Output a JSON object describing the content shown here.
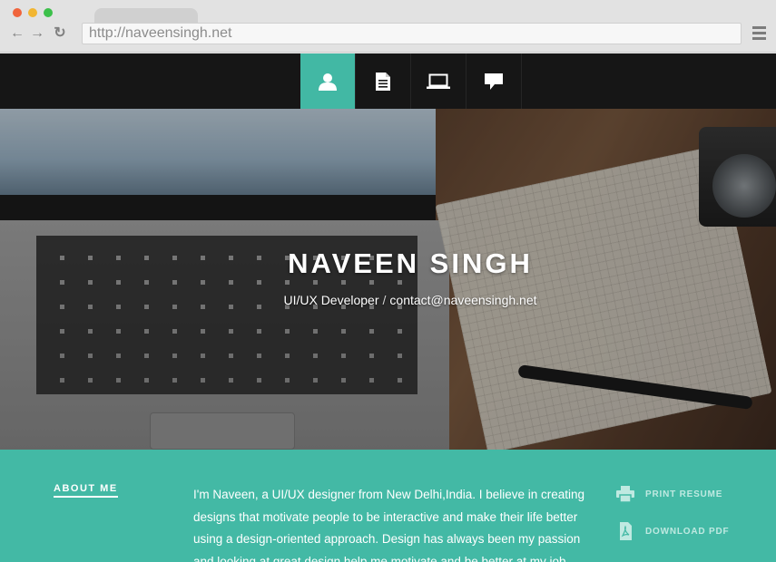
{
  "browser": {
    "url": "http://naveensingh.net",
    "icons": {
      "back": "back-arrow-icon",
      "forward": "forward-arrow-icon",
      "reload": "reload-icon",
      "menu": "hamburger-menu-icon"
    }
  },
  "nav": {
    "items": [
      {
        "icon": "user-icon",
        "active": true
      },
      {
        "icon": "document-icon",
        "active": false
      },
      {
        "icon": "laptop-icon",
        "active": false
      },
      {
        "icon": "speech-bubble-icon",
        "active": false
      }
    ],
    "accent": "#42b8a4"
  },
  "hero": {
    "title": "NAVEEN SINGH",
    "role": "UI/UX Developer",
    "separator": "/",
    "email": "contact@naveensingh.net"
  },
  "about": {
    "heading": "ABOUT ME",
    "paragraph": "I'm Naveen, a UI/UX designer from New Delhi,India. I believe in creating designs that motivate people to be interactive and make their life better using a design-oriented approach. Design has always been my passion and looking at great design help me motivate and be better at my job.",
    "background": "#43b9a5"
  },
  "actions": {
    "print_label": "PRINT RESUME",
    "pdf_label": "DOWNLOAD PDF",
    "print_icon": "printer-icon",
    "pdf_icon": "pdf-file-icon"
  }
}
